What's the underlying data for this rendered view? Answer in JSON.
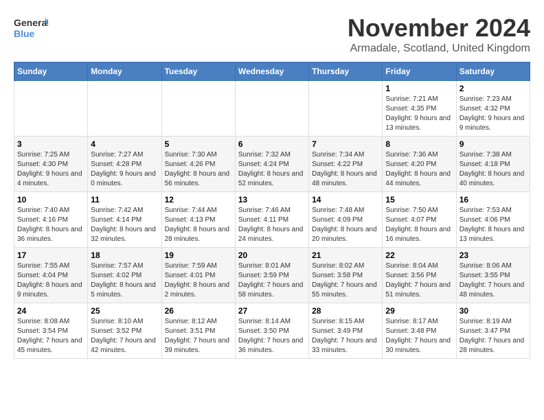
{
  "header": {
    "logo_general": "General",
    "logo_blue": "Blue",
    "month_year": "November 2024",
    "location": "Armadale, Scotland, United Kingdom"
  },
  "weekdays": [
    "Sunday",
    "Monday",
    "Tuesday",
    "Wednesday",
    "Thursday",
    "Friday",
    "Saturday"
  ],
  "weeks": [
    [
      {
        "day": "",
        "info": ""
      },
      {
        "day": "",
        "info": ""
      },
      {
        "day": "",
        "info": ""
      },
      {
        "day": "",
        "info": ""
      },
      {
        "day": "",
        "info": ""
      },
      {
        "day": "1",
        "info": "Sunrise: 7:21 AM\nSunset: 4:35 PM\nDaylight: 9 hours and 13 minutes."
      },
      {
        "day": "2",
        "info": "Sunrise: 7:23 AM\nSunset: 4:32 PM\nDaylight: 9 hours and 9 minutes."
      }
    ],
    [
      {
        "day": "3",
        "info": "Sunrise: 7:25 AM\nSunset: 4:30 PM\nDaylight: 9 hours and 4 minutes."
      },
      {
        "day": "4",
        "info": "Sunrise: 7:27 AM\nSunset: 4:28 PM\nDaylight: 9 hours and 0 minutes."
      },
      {
        "day": "5",
        "info": "Sunrise: 7:30 AM\nSunset: 4:26 PM\nDaylight: 8 hours and 56 minutes."
      },
      {
        "day": "6",
        "info": "Sunrise: 7:32 AM\nSunset: 4:24 PM\nDaylight: 8 hours and 52 minutes."
      },
      {
        "day": "7",
        "info": "Sunrise: 7:34 AM\nSunset: 4:22 PM\nDaylight: 8 hours and 48 minutes."
      },
      {
        "day": "8",
        "info": "Sunrise: 7:36 AM\nSunset: 4:20 PM\nDaylight: 8 hours and 44 minutes."
      },
      {
        "day": "9",
        "info": "Sunrise: 7:38 AM\nSunset: 4:18 PM\nDaylight: 8 hours and 40 minutes."
      }
    ],
    [
      {
        "day": "10",
        "info": "Sunrise: 7:40 AM\nSunset: 4:16 PM\nDaylight: 8 hours and 36 minutes."
      },
      {
        "day": "11",
        "info": "Sunrise: 7:42 AM\nSunset: 4:14 PM\nDaylight: 8 hours and 32 minutes."
      },
      {
        "day": "12",
        "info": "Sunrise: 7:44 AM\nSunset: 4:13 PM\nDaylight: 8 hours and 28 minutes."
      },
      {
        "day": "13",
        "info": "Sunrise: 7:46 AM\nSunset: 4:11 PM\nDaylight: 8 hours and 24 minutes."
      },
      {
        "day": "14",
        "info": "Sunrise: 7:48 AM\nSunset: 4:09 PM\nDaylight: 8 hours and 20 minutes."
      },
      {
        "day": "15",
        "info": "Sunrise: 7:50 AM\nSunset: 4:07 PM\nDaylight: 8 hours and 16 minutes."
      },
      {
        "day": "16",
        "info": "Sunrise: 7:53 AM\nSunset: 4:06 PM\nDaylight: 8 hours and 13 minutes."
      }
    ],
    [
      {
        "day": "17",
        "info": "Sunrise: 7:55 AM\nSunset: 4:04 PM\nDaylight: 8 hours and 9 minutes."
      },
      {
        "day": "18",
        "info": "Sunrise: 7:57 AM\nSunset: 4:02 PM\nDaylight: 8 hours and 5 minutes."
      },
      {
        "day": "19",
        "info": "Sunrise: 7:59 AM\nSunset: 4:01 PM\nDaylight: 8 hours and 2 minutes."
      },
      {
        "day": "20",
        "info": "Sunrise: 8:01 AM\nSunset: 3:59 PM\nDaylight: 7 hours and 58 minutes."
      },
      {
        "day": "21",
        "info": "Sunrise: 8:02 AM\nSunset: 3:58 PM\nDaylight: 7 hours and 55 minutes."
      },
      {
        "day": "22",
        "info": "Sunrise: 8:04 AM\nSunset: 3:56 PM\nDaylight: 7 hours and 51 minutes."
      },
      {
        "day": "23",
        "info": "Sunrise: 8:06 AM\nSunset: 3:55 PM\nDaylight: 7 hours and 48 minutes."
      }
    ],
    [
      {
        "day": "24",
        "info": "Sunrise: 8:08 AM\nSunset: 3:54 PM\nDaylight: 7 hours and 45 minutes."
      },
      {
        "day": "25",
        "info": "Sunrise: 8:10 AM\nSunset: 3:52 PM\nDaylight: 7 hours and 42 minutes."
      },
      {
        "day": "26",
        "info": "Sunrise: 8:12 AM\nSunset: 3:51 PM\nDaylight: 7 hours and 39 minutes."
      },
      {
        "day": "27",
        "info": "Sunrise: 8:14 AM\nSunset: 3:50 PM\nDaylight: 7 hours and 36 minutes."
      },
      {
        "day": "28",
        "info": "Sunrise: 8:15 AM\nSunset: 3:49 PM\nDaylight: 7 hours and 33 minutes."
      },
      {
        "day": "29",
        "info": "Sunrise: 8:17 AM\nSunset: 3:48 PM\nDaylight: 7 hours and 30 minutes."
      },
      {
        "day": "30",
        "info": "Sunrise: 8:19 AM\nSunset: 3:47 PM\nDaylight: 7 hours and 28 minutes."
      }
    ]
  ]
}
